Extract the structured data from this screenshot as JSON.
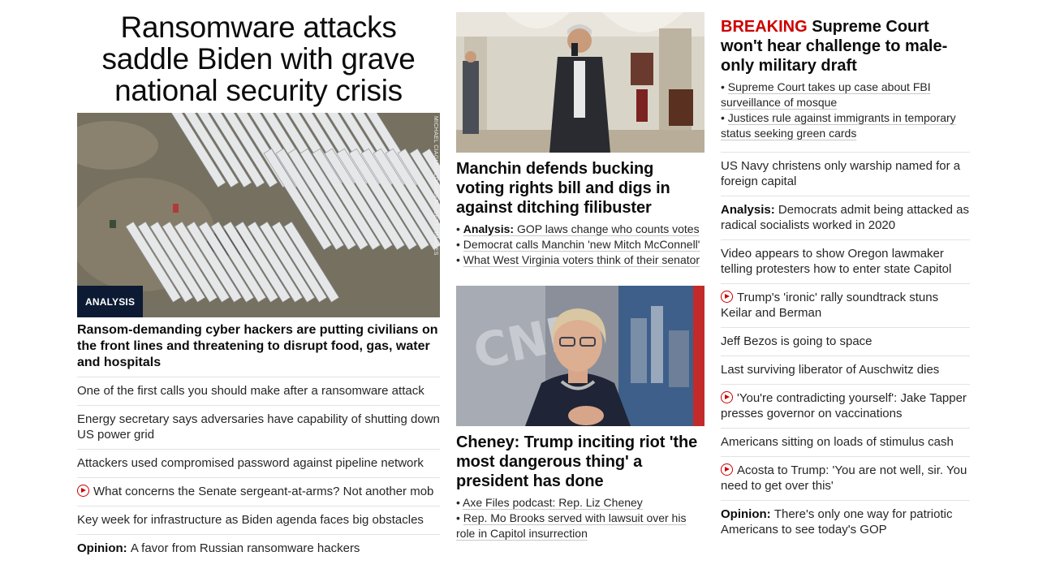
{
  "lead_story": {
    "headline": "Ransomware attacks saddle Biden with grave national security crisis",
    "image_credit": "MICHAEL CIAGLO/BLOOMBERG/GETTY IMAGES",
    "badge": "ANALYSIS",
    "title": "Ransom-demanding cyber hackers are putting civilians on the front lines and threatening to disrupt food, gas, water and hospitals",
    "related": [
      {
        "text": "One of the first calls you should make after a ransomware attack"
      },
      {
        "text": "Energy secretary says adversaries have capability of shutting down US power grid"
      },
      {
        "text": "Attackers used compromised password against pipeline network"
      },
      {
        "text": "What concerns the Senate sergeant-at-arms? Not another mob",
        "icon": "play-icon"
      },
      {
        "text": "Key week for infrastructure as Biden agenda faces big obstacles"
      },
      {
        "prefix": "Opinion:",
        "text": "A favor from Russian ransomware hackers"
      }
    ]
  },
  "manchin_story": {
    "title": "Manchin defends bucking voting rights bill and digs in against ditching filibuster",
    "bullets": [
      {
        "prefix": "Analysis:",
        "text": "GOP laws change who counts votes"
      },
      {
        "text": "Democrat calls Manchin 'new Mitch McConnell'"
      },
      {
        "text": "What West Virginia voters think of their senator"
      }
    ]
  },
  "cheney_story": {
    "title": "Cheney: Trump inciting riot 'the most dangerous thing' a president has done",
    "bullets": [
      {
        "text": "Axe Files podcast: Rep. Liz Cheney"
      },
      {
        "text": "Rep. Mo Brooks served with lawsuit over his role in Capitol insurrection"
      }
    ]
  },
  "breaking_story": {
    "label": "BREAKING",
    "title": "Supreme Court won't hear challenge to male-only military draft",
    "bullets": [
      {
        "text": "Supreme Court takes up case about FBI surveillance of mosque"
      },
      {
        "text": "Justices rule against immigrants in temporary status seeking green cards"
      }
    ]
  },
  "headlines": [
    {
      "text": "US Navy christens only warship named for a foreign capital"
    },
    {
      "prefix": "Analysis:",
      "text": "Democrats admit being attacked as radical socialists worked in 2020"
    },
    {
      "text": "Video appears to show Oregon lawmaker telling protesters how to enter state Capitol"
    },
    {
      "text": "Trump's 'ironic' rally soundtrack stuns Keilar and Berman",
      "icon": "play-icon"
    },
    {
      "text": "Jeff Bezos is going to space"
    },
    {
      "text": "Last surviving liberator of Auschwitz dies"
    },
    {
      "text": "'You're contradicting yourself': Jake Tapper presses governor on vaccinations",
      "icon": "play-icon"
    },
    {
      "text": "Americans sitting on loads of stimulus cash"
    },
    {
      "text": "Acosta to Trump: 'You are not well, sir. You need to get over this'",
      "icon": "play-icon"
    },
    {
      "prefix": "Opinion:",
      "text": "There's only one way for patriotic Americans to see today's GOP"
    }
  ],
  "colors": {
    "breaking": "#cc0000",
    "badge_bg": "#0c1a33",
    "divider": "#e3e3e3"
  }
}
